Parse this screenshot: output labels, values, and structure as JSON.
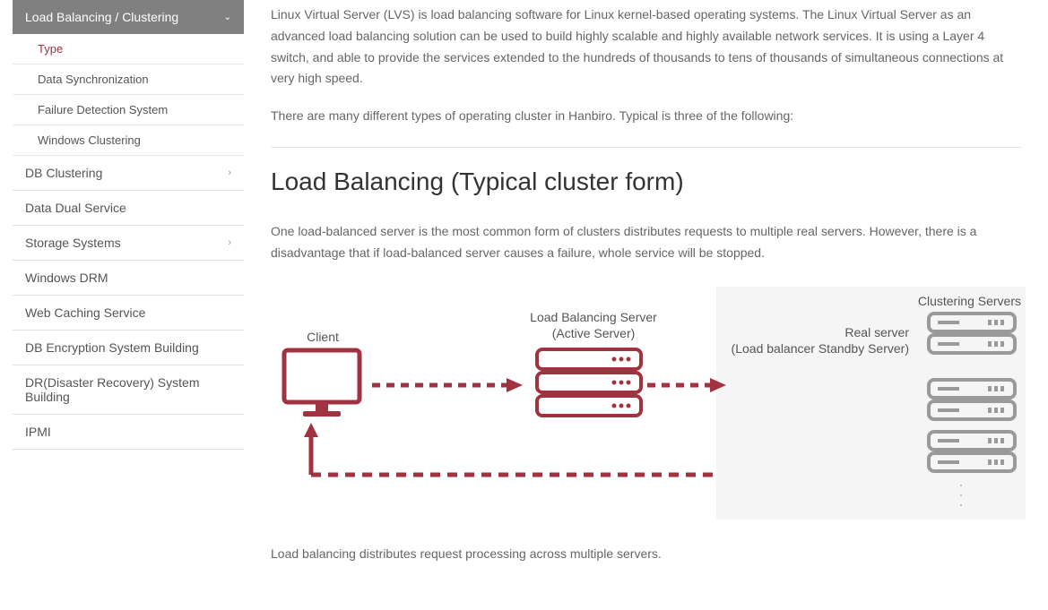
{
  "sidebar": {
    "header": "Load Balancing / Clustering",
    "sub_items": [
      {
        "label": "Type",
        "active": true
      },
      {
        "label": "Data Synchronization",
        "active": false
      },
      {
        "label": "Failure Detection System",
        "active": false
      },
      {
        "label": "Windows Clustering",
        "active": false
      }
    ],
    "menu": [
      {
        "label": "DB Clustering",
        "expandable": true
      },
      {
        "label": "Data Dual Service",
        "expandable": false
      },
      {
        "label": "Storage Systems",
        "expandable": true
      },
      {
        "label": "Windows DRM",
        "expandable": false
      },
      {
        "label": "Web Caching Service",
        "expandable": false
      },
      {
        "label": "DB Encryption System Building",
        "expandable": false
      },
      {
        "label": "DR(Disaster Recovery) System Building",
        "expandable": false
      },
      {
        "label": "IPMI",
        "expandable": false
      }
    ]
  },
  "content": {
    "intro": "Linux Virtual Server (LVS) is load balancing software for Linux kernel-based operating systems. The Linux Virtual Server as an advanced load balancing solution can be used to build highly scalable and highly available network services. It is using a Layer 4 switch, and able to provide the services extended to the hundreds of thousands to tens of thousands of simultaneous connections at very high speed.",
    "intro2": "There are many different types of operating cluster in Hanbiro. Typical is three of the following:",
    "section_title": "Load Balancing (Typical cluster form)",
    "section_desc": "One load-balanced server is the most common form of clusters distributes requests to multiple real servers. However, there is a disadvantage that if load-balanced server causes a failure, whole service will be stopped.",
    "diagram": {
      "client_label": "Client",
      "lb_label_line1": "Load Balancing Server",
      "lb_label_line2": "(Active Server)",
      "cluster_heading": "Clustering Servers",
      "real_label_line1": "Real server",
      "real_label_line2": "(Load balancer Standby Server)"
    },
    "caption": "Load balancing distributes request processing across multiple servers."
  },
  "colors": {
    "accent": "#a13240",
    "gray_server": "#9a9a9a"
  }
}
